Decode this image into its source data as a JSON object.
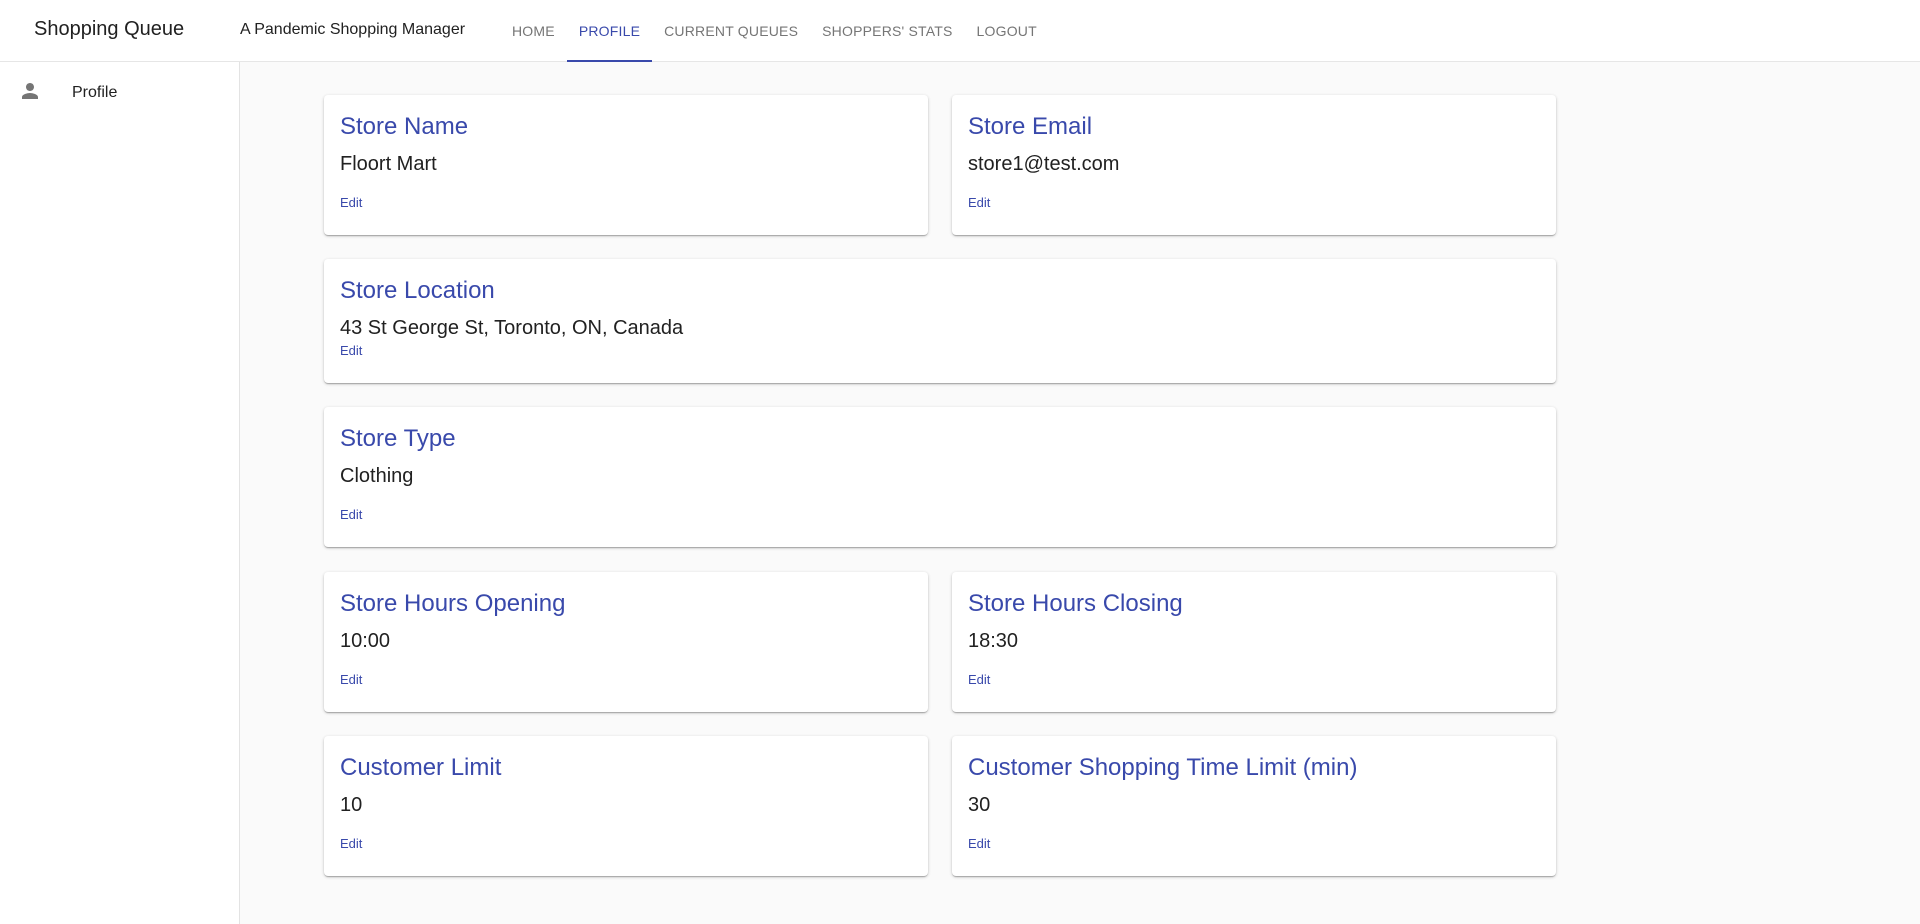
{
  "header": {
    "brand": "Shopping Queue",
    "tagline": "A Pandemic Shopping Manager",
    "tabs": [
      {
        "label": "HOME"
      },
      {
        "label": "PROFILE"
      },
      {
        "label": "CURRENT QUEUES"
      },
      {
        "label": "SHOPPERS' STATS"
      },
      {
        "label": "LOGOUT"
      }
    ],
    "active_tab": "PROFILE"
  },
  "sidebar": {
    "items": [
      {
        "label": "Profile",
        "icon": "person-icon"
      }
    ]
  },
  "cards": {
    "store_name": {
      "title": "Store Name",
      "value": "Floort Mart",
      "edit": "Edit"
    },
    "store_email": {
      "title": "Store Email",
      "value": "store1@test.com",
      "edit": "Edit"
    },
    "store_location": {
      "title": "Store Location",
      "value": "43 St George St, Toronto, ON, Canada",
      "edit": "Edit"
    },
    "store_type": {
      "title": "Store Type",
      "value": "Clothing",
      "edit": "Edit"
    },
    "hours_opening": {
      "title": "Store Hours Opening",
      "value": "10:00",
      "edit": "Edit"
    },
    "hours_closing": {
      "title": "Store Hours Closing",
      "value": "18:30",
      "edit": "Edit"
    },
    "customer_limit": {
      "title": "Customer Limit",
      "value": "10",
      "edit": "Edit"
    },
    "time_limit": {
      "title": "Customer Shopping Time Limit (min)",
      "value": "30",
      "edit": "Edit"
    }
  },
  "colors": {
    "accent": "#3949ab",
    "background": "#fafafa",
    "text": "#212121",
    "muted": "#757575"
  }
}
